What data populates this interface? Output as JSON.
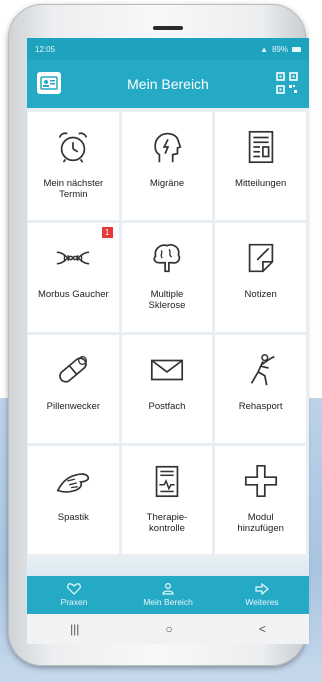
{
  "status": {
    "time": "12:05",
    "battery": "89%"
  },
  "header": {
    "title": "Mein Bereich"
  },
  "tiles": [
    {
      "label": "Mein nächster\nTermin",
      "icon": "alarm-clock-icon"
    },
    {
      "label": "Migräne",
      "icon": "head-lightning-icon"
    },
    {
      "label": "Mitteilungen",
      "icon": "newspaper-icon"
    },
    {
      "label": "Morbus Gaucher",
      "icon": "dna-icon",
      "badge": "1"
    },
    {
      "label": "Multiple\nSklerose",
      "icon": "brain-icon"
    },
    {
      "label": "Notizen",
      "icon": "notepad-icon"
    },
    {
      "label": "Pillenwecker",
      "icon": "pill-icon"
    },
    {
      "label": "Postfach",
      "icon": "envelope-icon"
    },
    {
      "label": "Rehasport",
      "icon": "exercise-icon"
    },
    {
      "label": "Spastik",
      "icon": "hands-icon"
    },
    {
      "label": "Therapie-\nkontrolle",
      "icon": "clipboard-chart-icon"
    },
    {
      "label": "Modul\nhinzufügen",
      "icon": "plus-icon"
    }
  ],
  "tabs": [
    {
      "label": "Praxen",
      "icon": "heart-icon"
    },
    {
      "label": "Mein Bereich",
      "icon": "person-icon"
    },
    {
      "label": "Weiteres",
      "icon": "arrow-right-icon"
    }
  ],
  "navbar": {
    "recent": "|||",
    "home": "○",
    "back": "<"
  }
}
